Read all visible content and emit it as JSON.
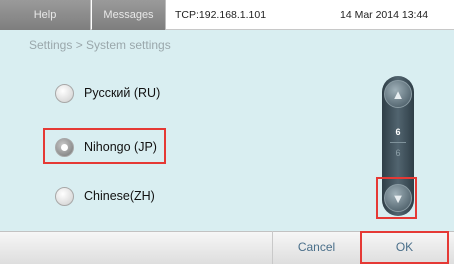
{
  "header": {
    "tabs": [
      {
        "label": "Help"
      },
      {
        "label": "Messages"
      }
    ],
    "connection": "TCP:192.168.1.101",
    "datetime": "14 Mar 2014  13:44"
  },
  "breadcrumb": "Settings > System settings",
  "languages": [
    {
      "label": "Русский (RU)",
      "selected": false
    },
    {
      "label": "Nihongo (JP)",
      "selected": true
    },
    {
      "label": "Chinese(ZH)",
      "selected": false
    }
  ],
  "scroller": {
    "up_icon": "chevron-up-icon",
    "down_icon": "chevron-down-icon",
    "current_page": "6",
    "total_pages": "6"
  },
  "footer": {
    "cancel_label": "Cancel",
    "ok_label": "OK"
  },
  "colors": {
    "background": "#d9eef1",
    "highlight": "#e53935",
    "button_text": "#4a6f8a"
  }
}
